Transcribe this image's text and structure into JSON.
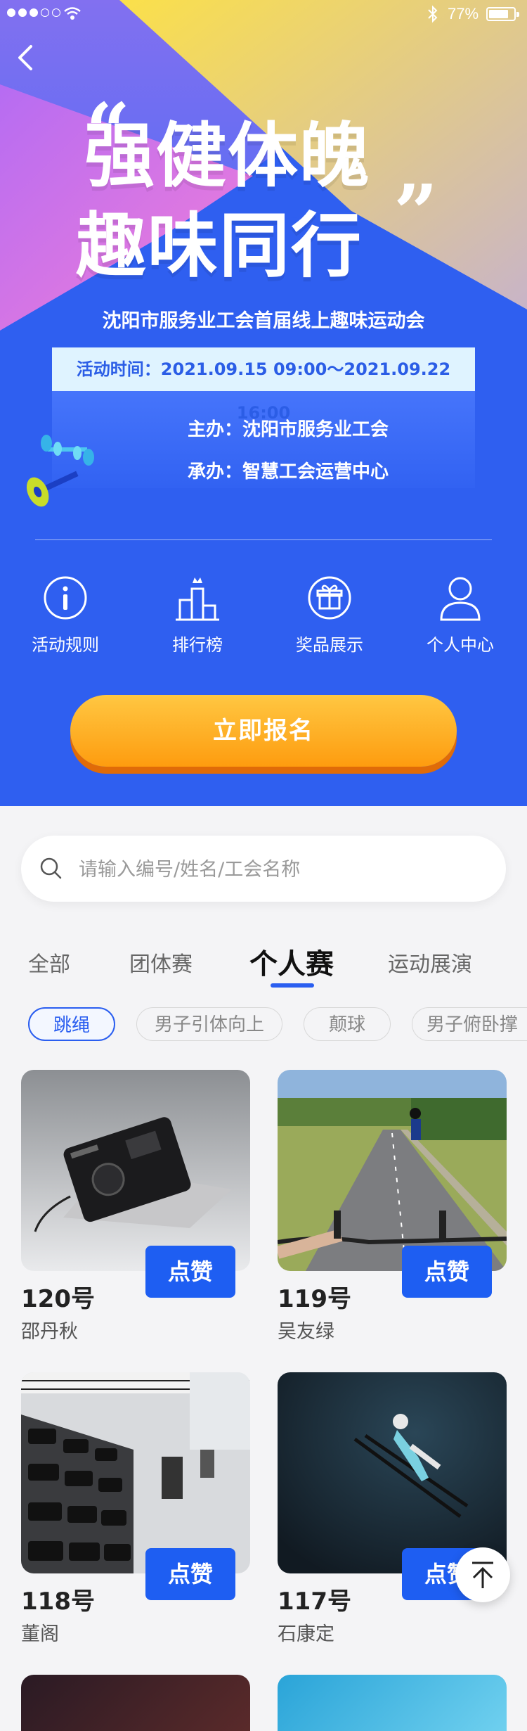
{
  "status_bar": {
    "battery_text": "77%"
  },
  "hero": {
    "title_line1": "强健体魄",
    "title_line2": "趣味同行",
    "open_quote": "“",
    "close_quote": "”",
    "subtitle": "沈阳市服务业工会首届线上趣味运动会",
    "time_label": "活动时间：2021.09.15 09:00～2021.09.22 16:00",
    "organizer": "主办：沈阳市服务业工会",
    "co_organizer": "承办：智慧工会运营中心"
  },
  "nav": [
    {
      "label": "活动规则",
      "icon": "info-icon"
    },
    {
      "label": "排行榜",
      "icon": "ranking-icon"
    },
    {
      "label": "奖品展示",
      "icon": "gift-icon"
    },
    {
      "label": "个人中心",
      "icon": "user-icon"
    }
  ],
  "signup_label": "立即报名",
  "search": {
    "placeholder": "请输入编号/姓名/工会名称"
  },
  "tabs": [
    {
      "label": "全部",
      "active": false
    },
    {
      "label": "团体赛",
      "active": false
    },
    {
      "label": "个人赛",
      "active": true
    },
    {
      "label": "运动展演",
      "active": false
    }
  ],
  "chips": [
    {
      "label": "跳绳",
      "active": true
    },
    {
      "label": "男子引体向上",
      "active": false
    },
    {
      "label": "颠球",
      "active": false
    },
    {
      "label": "男子俯卧撑",
      "active": false
    }
  ],
  "cards": [
    {
      "number": "120号",
      "name": "邵丹秋",
      "like_label": "点赞",
      "image": "camera-photo"
    },
    {
      "number": "119号",
      "name": "吴友绿",
      "like_label": "点赞",
      "image": "cycling-road-photo"
    },
    {
      "number": "118号",
      "name": "董阁",
      "like_label": "点赞",
      "image": "gym-dumbbell-photo"
    },
    {
      "number": "117号",
      "name": "石康定",
      "like_label": "点赞",
      "image": "ski-jump-photo"
    }
  ],
  "colors": {
    "primary": "#2a5ef0",
    "hero_bg": "#2f5ff0",
    "button_orange": "#fe9c0f"
  }
}
